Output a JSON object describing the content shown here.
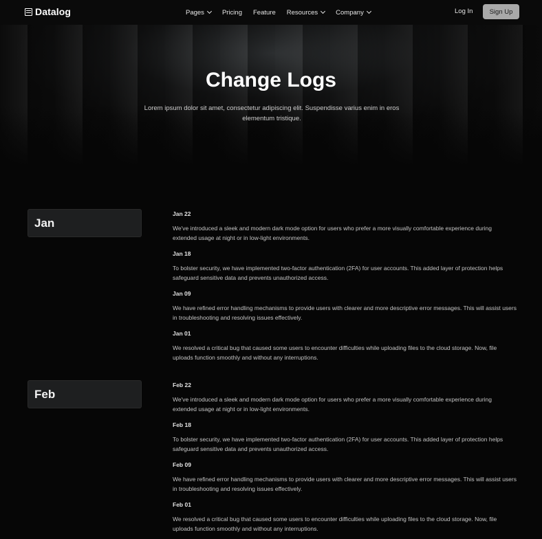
{
  "brand": {
    "name": "Datalog",
    "icon": "table-icon"
  },
  "nav": {
    "items": [
      {
        "label": "Pages",
        "dropdown": true
      },
      {
        "label": "Pricing",
        "dropdown": false
      },
      {
        "label": "Feature",
        "dropdown": false
      },
      {
        "label": "Resources",
        "dropdown": true
      },
      {
        "label": "Company",
        "dropdown": true
      }
    ],
    "login_label": "Log In",
    "signup_label": "Sign Up"
  },
  "hero": {
    "title": "Change Logs",
    "subtitle": "Lorem ipsum dolor sit amet, consectetur adipiscing elit. Suspendisse varius enim in eros elementum tristique."
  },
  "months": [
    {
      "label": "Jan",
      "entries": [
        {
          "date": "Jan 22",
          "text": "We've introduced a sleek and modern dark mode option for users who prefer a more visually comfortable experience during extended usage at night or in low-light environments."
        },
        {
          "date": "Jan 18",
          "text": "To bolster security, we have implemented two-factor authentication (2FA) for user accounts. This added layer of protection helps safeguard sensitive data and prevents unauthorized access."
        },
        {
          "date": "Jan 09",
          "text": "We have refined error handling mechanisms to provide users with clearer and more descriptive error messages. This will assist users in troubleshooting and resolving issues effectively."
        },
        {
          "date": "Jan 01",
          "text": "We resolved a critical bug that caused some users to encounter difficulties while uploading files to the cloud storage. Now, file uploads function smoothly and without any interruptions."
        }
      ]
    },
    {
      "label": "Feb",
      "entries": [
        {
          "date": "Feb 22",
          "text": "We've introduced a sleek and modern dark mode option for users who prefer a more visually comfortable experience during extended usage at night or in low-light environments."
        },
        {
          "date": "Feb 18",
          "text": "To bolster security, we have implemented two-factor authentication (2FA) for user accounts. This added layer of protection helps safeguard sensitive data and prevents unauthorized access."
        },
        {
          "date": "Feb 09",
          "text": "We have refined error handling mechanisms to provide users with clearer and more descriptive error messages. This will assist users in troubleshooting and resolving issues effectively."
        },
        {
          "date": "Feb 01",
          "text": "We resolved a critical bug that caused some users to encounter difficulties while uploading files to the cloud storage. Now, file uploads function smoothly and without any interruptions."
        }
      ]
    }
  ],
  "colors": {
    "background": "#060606",
    "signup_button": "#a9a9a9",
    "badge": "#1e1f20"
  }
}
